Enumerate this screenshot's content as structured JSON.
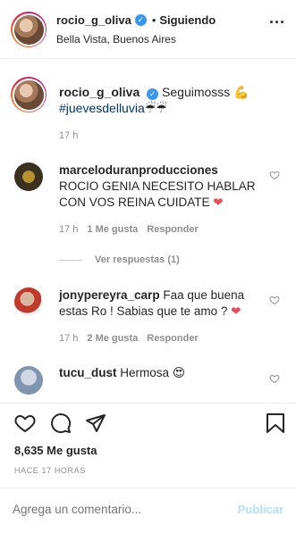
{
  "header": {
    "username": "rocio_g_oliva",
    "separator": "•",
    "follow_status": "Siguiendo",
    "location": "Bella Vista, Buenos Aires",
    "more_icon": "more-horizontal-icon"
  },
  "caption": {
    "username": "rocio_g_oliva",
    "text": "Seguimosss 💪",
    "hashtag": "#juevesdelluvia",
    "emoji": "☔☔",
    "time": "17 h"
  },
  "comments": [
    {
      "username": "marceloduranproducciones",
      "text": "ROCIO GENIA NECESITO HABLAR CON VOS REINA CUIDATE",
      "emoji": "❤",
      "time": "17 h",
      "likes": "1 Me gusta",
      "reply": "Responder",
      "view_replies": "Ver respuestas (1)"
    },
    {
      "username": "jonypereyra_carp",
      "text": "Faa que buena estas Ro ! Sabias que te amo ?",
      "emoji": "❤",
      "time": "17 h",
      "likes": "2 Me gusta",
      "reply": "Responder"
    },
    {
      "username": "tucu_dust",
      "text": "Hermosa",
      "emoji": "😍"
    }
  ],
  "actions": {
    "likes": "8,635 Me gusta",
    "time_ago": "HACE 17 HORAS"
  },
  "comment_box": {
    "placeholder": "Agrega un comentario...",
    "publish_label": "Publicar"
  },
  "colors": {
    "verified": "#3897f0",
    "hashtag": "#00376b",
    "secondary_text": "#8e8e8e",
    "publish_disabled": "#b2dffc",
    "heart_red": "#ed4956"
  }
}
